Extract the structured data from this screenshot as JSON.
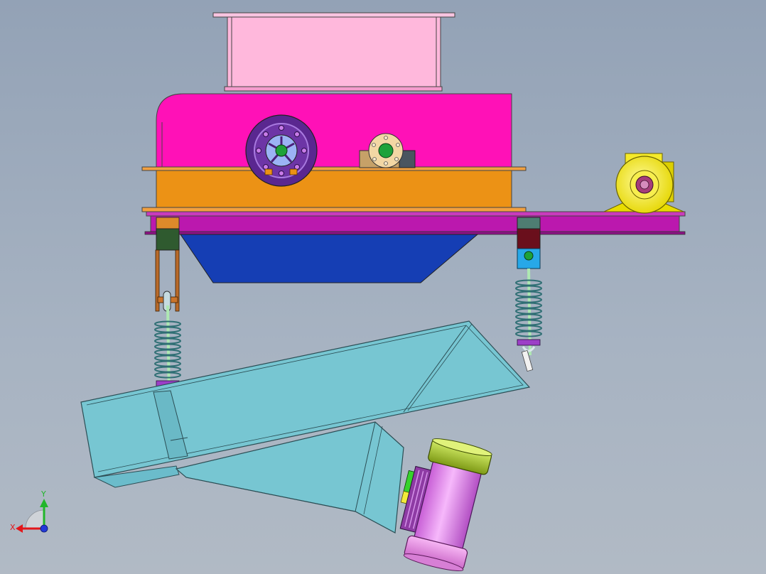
{
  "view": {
    "type": "cad-3d-viewport",
    "background_top": "#93a2b6",
    "background_bottom": "#b1bac5"
  },
  "model": {
    "parts": [
      {
        "name": "hopper-inlet",
        "color": "#ffb8dc"
      },
      {
        "name": "crusher-upper-housing",
        "color": "#ff11b7"
      },
      {
        "name": "crusher-lower-housing",
        "color": "#ec9215"
      },
      {
        "name": "flywheel",
        "color": "#5a2790"
      },
      {
        "name": "bearing-block",
        "color": "#f3d7a4"
      },
      {
        "name": "support-frame",
        "color": "#bb18ae"
      },
      {
        "name": "discharge-chute",
        "color": "#153eb4"
      },
      {
        "name": "drive-motor",
        "color": "#f6ed12"
      },
      {
        "name": "suspension-spring",
        "color": "#3a9aa3"
      },
      {
        "name": "vibrating-feeder-trough",
        "color": "#77c6d2"
      },
      {
        "name": "vibration-motor",
        "color": "#ea92ef"
      }
    ]
  },
  "triad": {
    "x_label": "X",
    "y_label": "Y",
    "x_color": "#e3161a",
    "y_color": "#21b62a",
    "z_color": "#2239d8"
  }
}
